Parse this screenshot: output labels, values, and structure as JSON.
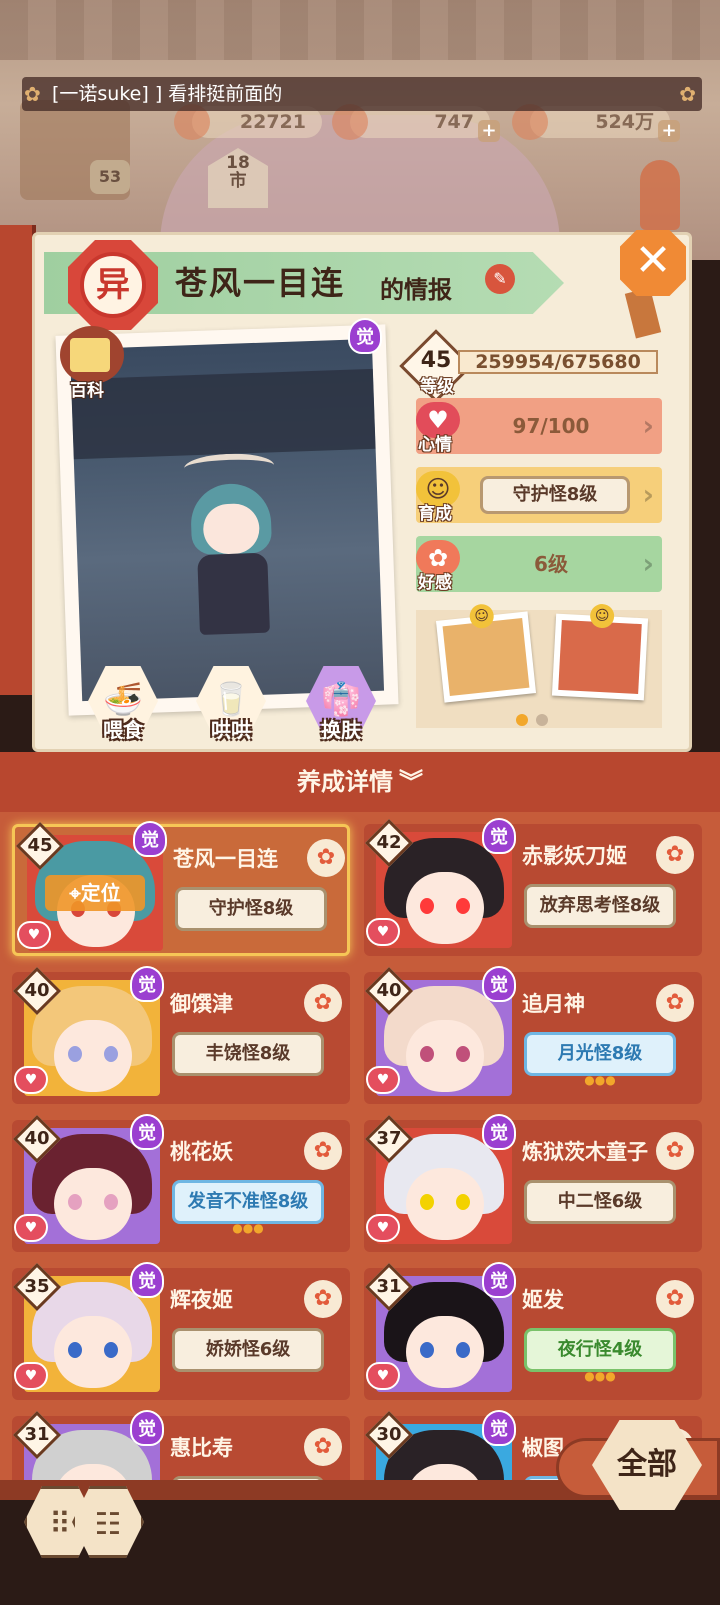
{
  "chat": {
    "message": "[一诺suke] ] 看排挺前面的"
  },
  "resources": {
    "r1": "22721",
    "r2": "747",
    "r3": "524万",
    "shop_level": "53",
    "market": "18\n市"
  },
  "panel": {
    "rank": "异",
    "title": "苍风一目连",
    "title_suffix": "的情报",
    "encyclopedia": "百科",
    "awaken": "觉",
    "actions": {
      "feed": "喂食",
      "pet": "哄哄",
      "skin": "换肤"
    },
    "level": {
      "value": "45",
      "label": "等级",
      "exp": "259954/675680"
    },
    "mood": {
      "label": "心情",
      "value": "97/100",
      "fraction": 0.97
    },
    "growth": {
      "label": "育成",
      "value": "守护怪8级"
    },
    "favor": {
      "label": "好感",
      "value": "6级"
    }
  },
  "roster": {
    "title": "养成详情",
    "cards": [
      {
        "level": "45",
        "name": "苍风一目连",
        "tag": "守护怪8级",
        "tag_style": "normal",
        "selected": true,
        "locate": "定位"
      },
      {
        "level": "42",
        "name": "赤影妖刀姬",
        "tag": "放弃思考怪8级",
        "tag_style": "normal",
        "selected": false
      },
      {
        "level": "40",
        "name": "御馔津",
        "tag": "丰饶怪8级",
        "tag_style": "normal",
        "selected": false
      },
      {
        "level": "40",
        "name": "追月神",
        "tag": "月光怪8级",
        "tag_style": "blue",
        "selected": false
      },
      {
        "level": "40",
        "name": "桃花妖",
        "tag": "发音不准怪8级",
        "tag_style": "blue",
        "selected": false
      },
      {
        "level": "37",
        "name": "炼狱茨木童子",
        "tag": "中二怪6级",
        "tag_style": "normal",
        "selected": false
      },
      {
        "level": "35",
        "name": "辉夜姬",
        "tag": "娇娇怪6级",
        "tag_style": "normal",
        "selected": false
      },
      {
        "level": "31",
        "name": "姬发",
        "tag": "夜行怪4级",
        "tag_style": "green",
        "selected": false
      },
      {
        "level": "31",
        "name": "惠比寿",
        "tag": "",
        "tag_style": "normal",
        "selected": false
      },
      {
        "level": "30",
        "name": "椒图",
        "tag": "",
        "tag_style": "blue",
        "selected": false
      }
    ],
    "awaken": "觉",
    "all_button": "全部"
  }
}
